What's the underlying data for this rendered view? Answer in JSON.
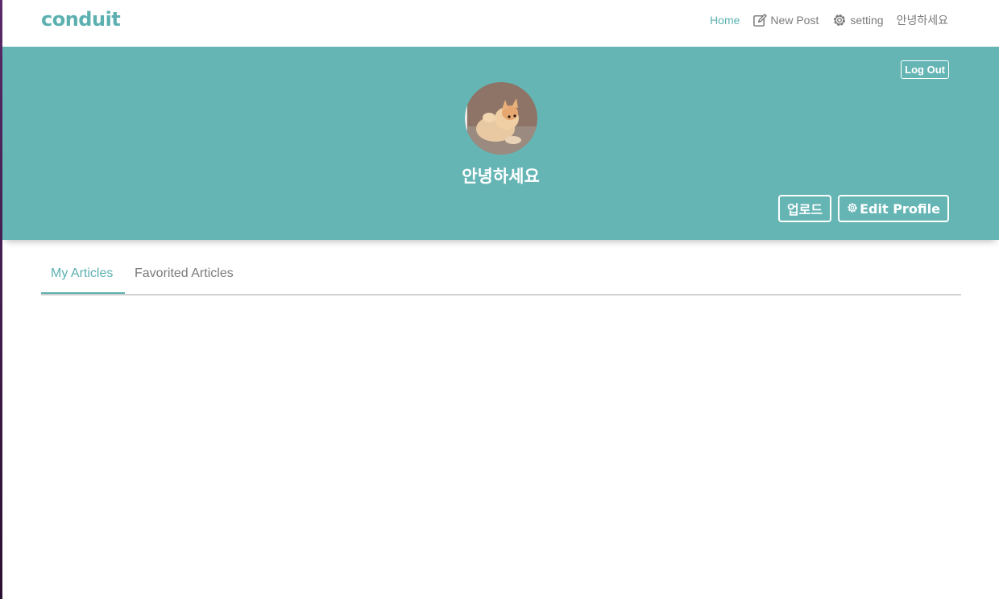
{
  "navbar": {
    "brand": "conduit",
    "items": [
      {
        "label": "Home",
        "icon": null,
        "active": true
      },
      {
        "label": "New Post",
        "icon": "edit-icon",
        "active": false
      },
      {
        "label": "setting",
        "icon": "gear-icon",
        "active": false
      },
      {
        "label": "안녕하세요",
        "icon": null,
        "active": false
      }
    ]
  },
  "profile": {
    "logout_label": "Log Out",
    "avatar": "cat-photo",
    "username": "안녕하세요",
    "upload_label": "업로드",
    "edit_profile_label": "Edit Profile"
  },
  "tabs": [
    {
      "label": "My Articles",
      "active": true
    },
    {
      "label": "Favorited Articles",
      "active": false
    }
  ],
  "colors": {
    "brand": "#5cb0b0",
    "hero_bg": "#66b5b5",
    "muted_text": "#7b7b7b"
  }
}
